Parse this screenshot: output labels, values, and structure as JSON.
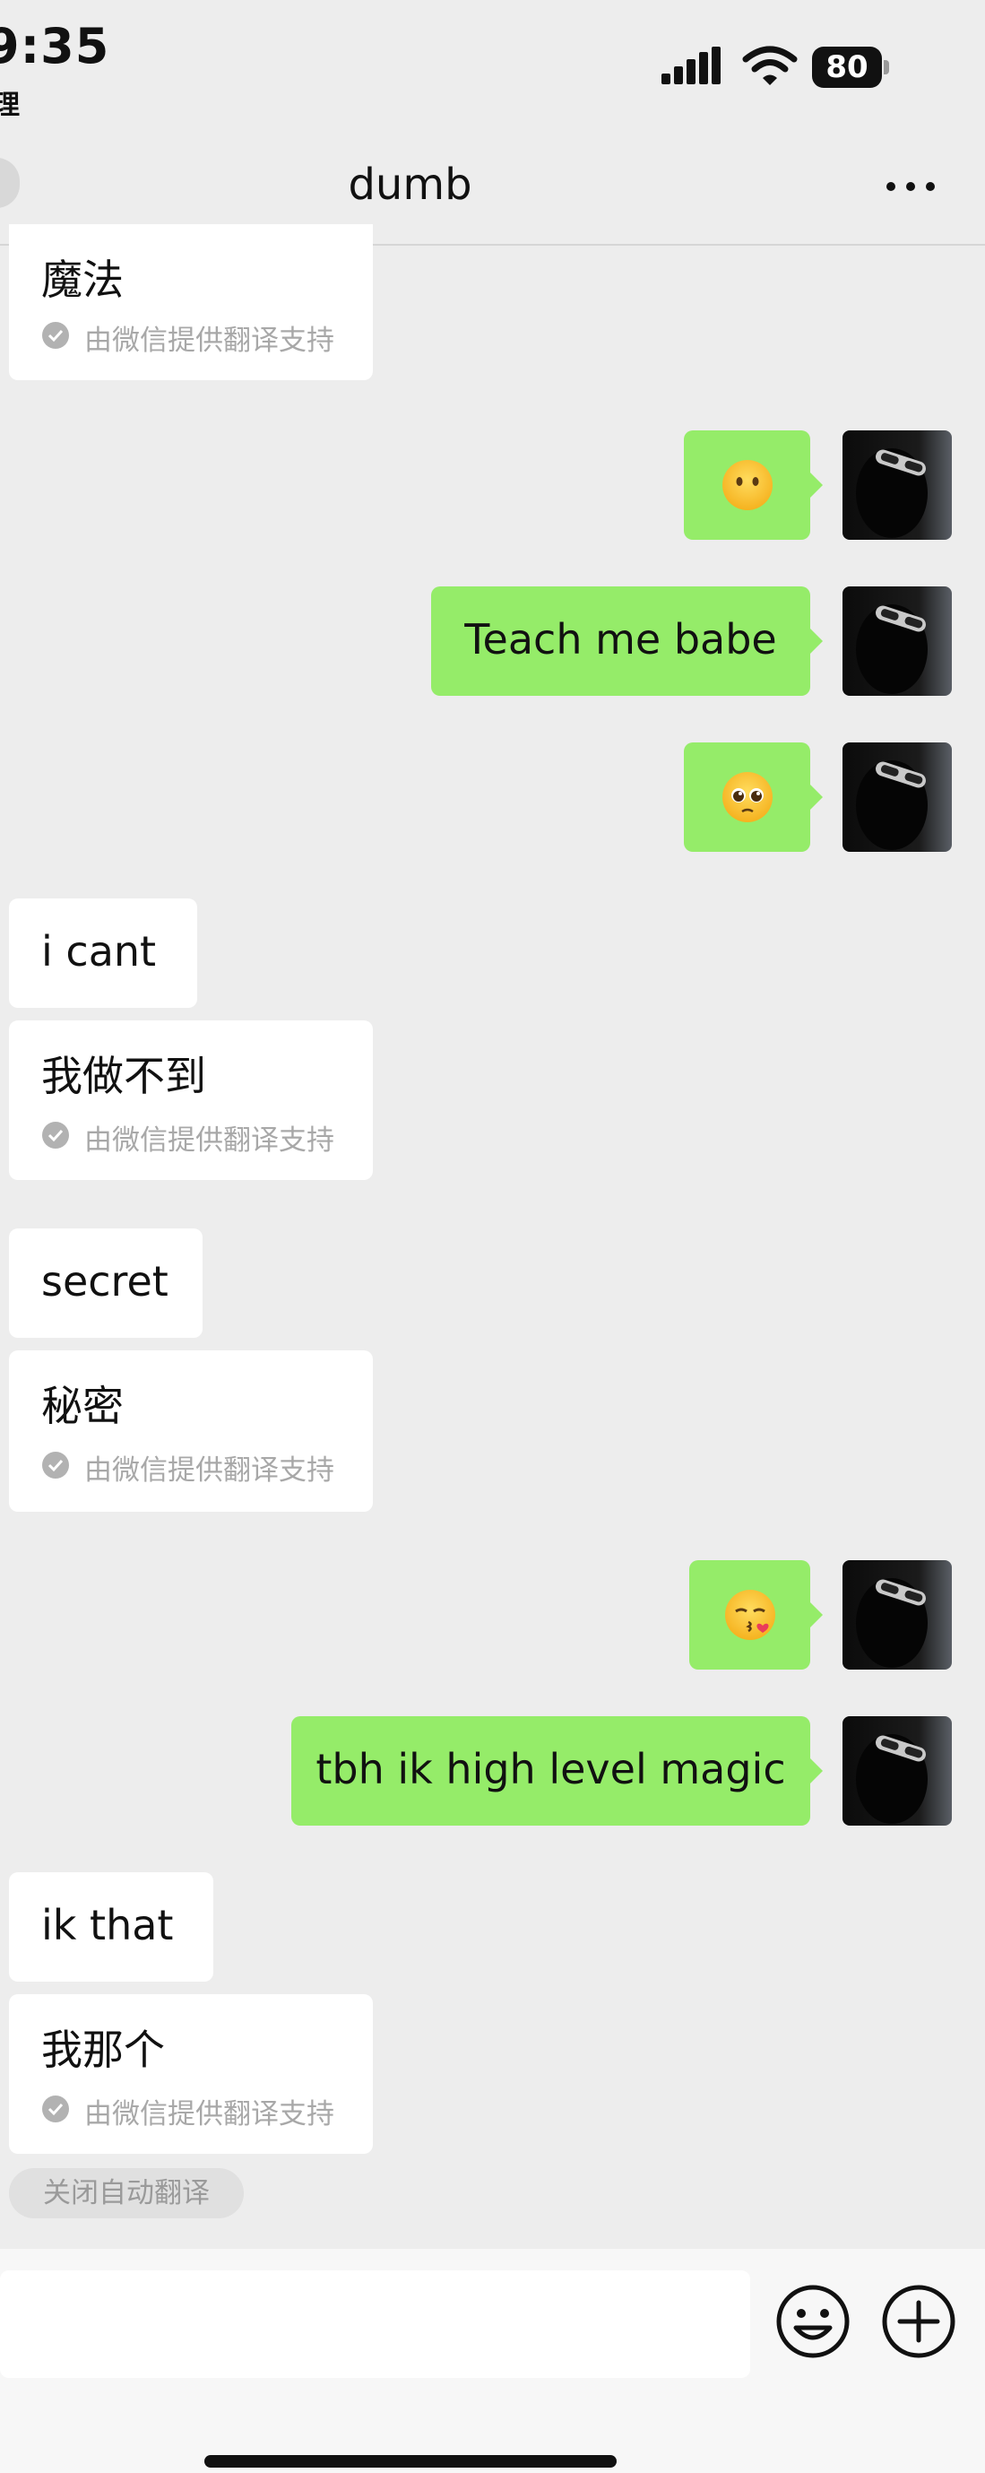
{
  "status_bar": {
    "time": "9:35",
    "sub_text": "理",
    "battery": "80"
  },
  "header": {
    "title": "dumb"
  },
  "colors": {
    "bg": "#ededed",
    "outgoing_bubble": "#95ec69",
    "incoming_bubble": "#ffffff"
  },
  "translation_note": "由微信提供翻译支持",
  "messages": {
    "m0": {
      "translation": "魔法"
    },
    "m1": {
      "emoji": "neutral-face"
    },
    "m2": {
      "text": "Teach me babe"
    },
    "m3": {
      "emoji": "pleading-face"
    },
    "m4": {
      "text": "i cant",
      "translation": "我做不到"
    },
    "m5": {
      "text": "secret",
      "translation": "秘密"
    },
    "m6": {
      "emoji": "face-blowing-kiss"
    },
    "m7": {
      "text": "tbh ik high level magic"
    },
    "m8": {
      "text": "ik that",
      "translation": "我那个"
    }
  },
  "auto_translate_off": "关闭自动翻译",
  "input": {
    "value": ""
  }
}
